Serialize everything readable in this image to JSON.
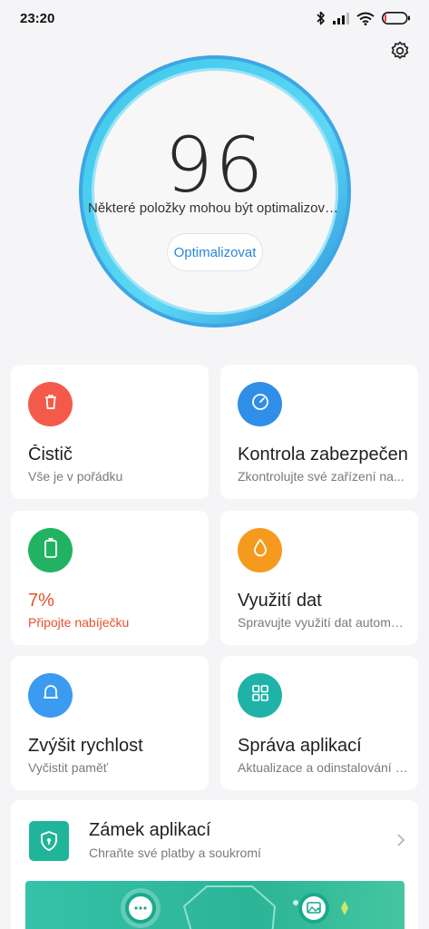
{
  "status_bar": {
    "time": "23:20",
    "icons": [
      "bluetooth-icon",
      "signal-icon",
      "wifi-icon",
      "battery-icon"
    ],
    "battery_level_percent": 7
  },
  "header": {
    "settings_icon": "gear-icon"
  },
  "score": {
    "value": "96",
    "message": "Některé položky mohou být optimalizovány",
    "button_label": "Optimalizovat",
    "ring_colors": [
      "#3ec6ec",
      "#5cd8f4",
      "#2b8fd8"
    ]
  },
  "cards": [
    {
      "id": "cleaner",
      "icon": "trash-icon",
      "color": "#f35a4a",
      "title": "Čistič",
      "subtitle": "Vše je v pořádku",
      "warning": false
    },
    {
      "id": "security",
      "icon": "gauge-icon",
      "color": "#2f8fe8",
      "title": "Kontrola zabezpečení",
      "subtitle": "Zkontrolujte své zařízení na...",
      "warning": false
    },
    {
      "id": "battery",
      "icon": "battery-icon",
      "color": "#21b361",
      "title": "7%",
      "subtitle": "Připojte nabíječku",
      "warning": true
    },
    {
      "id": "data",
      "icon": "drop-icon",
      "color": "#f59a1f",
      "title": "Využití dat",
      "subtitle": "Spravujte využití dat automaticky",
      "warning": false
    },
    {
      "id": "boost",
      "icon": "bell-icon",
      "color": "#3a9bf0",
      "title": "Zvýšit rychlost",
      "subtitle": "Vyčistit paměť",
      "warning": false
    },
    {
      "id": "apps",
      "icon": "grid-icon",
      "color": "#1fb2a6",
      "title": "Správa aplikací",
      "subtitle": "Aktualizace a odinstalování aplikací",
      "warning": false
    }
  ],
  "app_lock": {
    "icon": "shield-lock-icon",
    "title": "Zámek aplikací",
    "subtitle": "Chraňte své platby a soukromí",
    "chevron_icon": "chevron-right-icon",
    "banner_icons": [
      "chat-icon",
      "gallery-icon"
    ]
  }
}
